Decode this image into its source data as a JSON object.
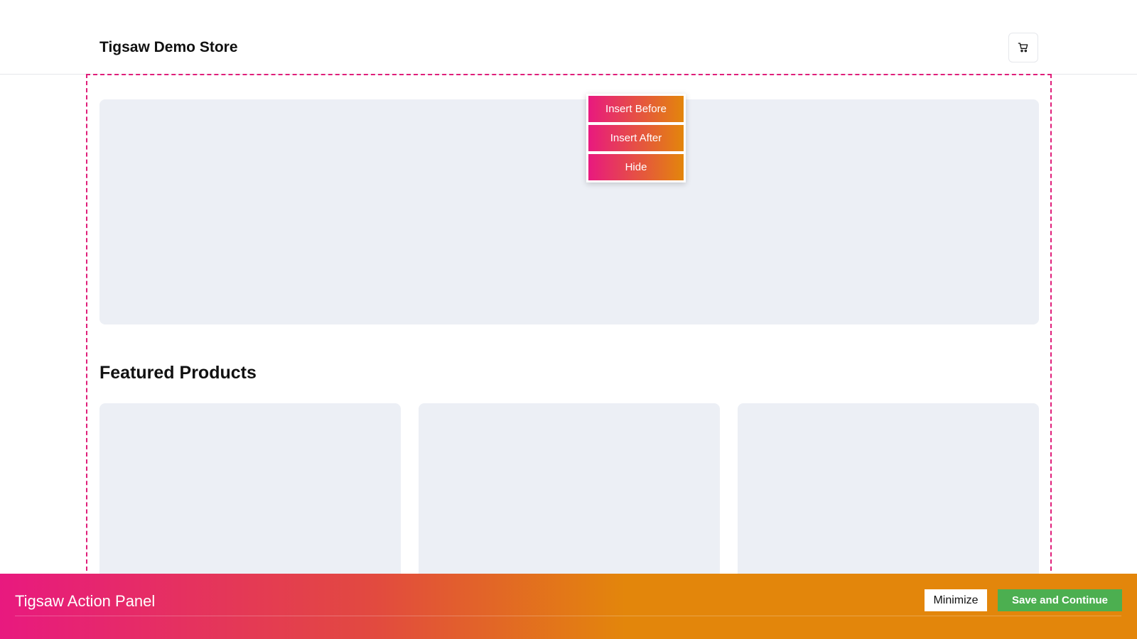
{
  "header": {
    "store_title": "Tigsaw Demo Store",
    "cart_icon": "shopping-cart-icon"
  },
  "main": {
    "section_heading": "Featured Products",
    "product_cards_count": 3
  },
  "context_menu": {
    "items": [
      {
        "label": "Insert Before"
      },
      {
        "label": "Insert After"
      },
      {
        "label": "Hide"
      }
    ]
  },
  "action_panel": {
    "title": "Tigsaw Action Panel",
    "minimize_label": "Minimize",
    "save_label": "Save and Continue"
  },
  "colors": {
    "accent_pink": "#e8197f",
    "accent_orange": "#e3860b",
    "save_green": "#4caf50",
    "placeholder_bg": "#eceff5"
  }
}
